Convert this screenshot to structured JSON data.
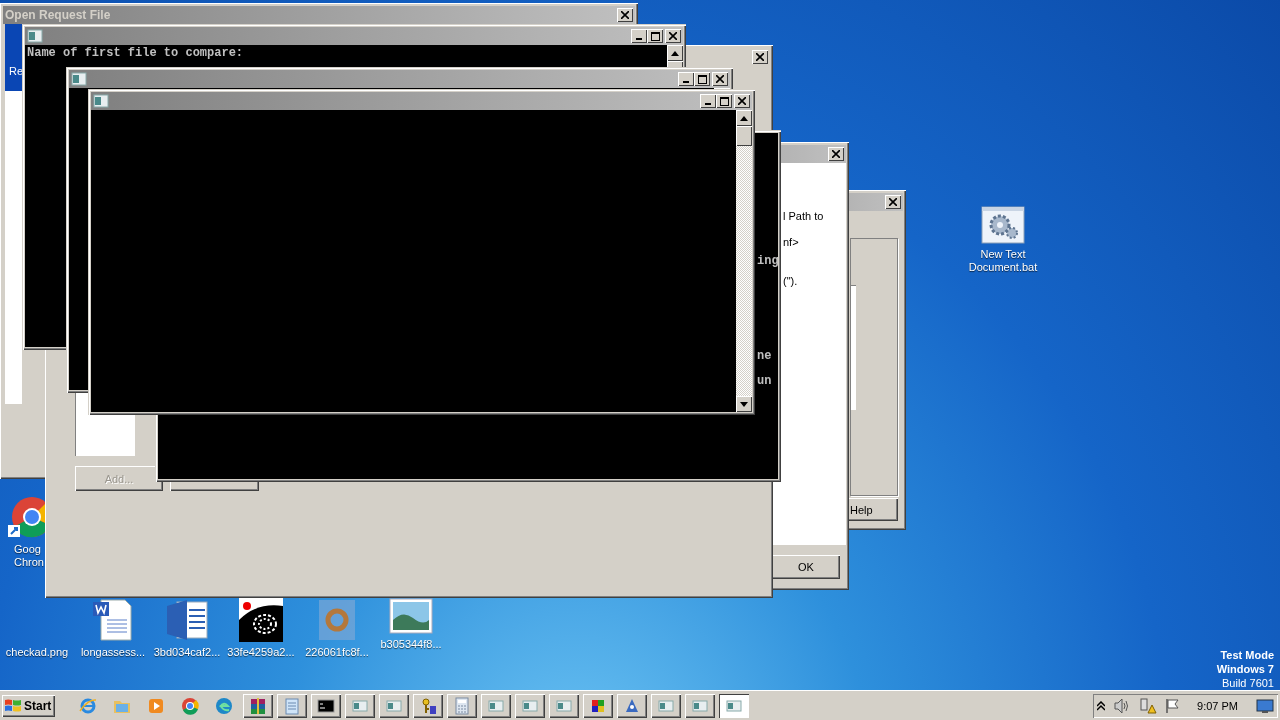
{
  "desktop": {
    "icons": [
      {
        "kind": "chrome",
        "label": "Goog Chron"
      },
      {
        "kind": "batch",
        "label": "New Text Document.bat"
      },
      {
        "kind": "blank",
        "label": "checkad.png"
      },
      {
        "kind": "word-doc",
        "label": "longassess..."
      },
      {
        "kind": "word-app",
        "label": "3bd034caf2..."
      },
      {
        "kind": "fingerprint",
        "label": "33fe4259a2..."
      },
      {
        "kind": "faded",
        "label": "226061fc8f..."
      },
      {
        "kind": "picture",
        "label": "b305344f8..."
      }
    ],
    "system_text": [
      "Test Mode",
      "Windows 7",
      "Build 7601"
    ]
  },
  "open_request_file": {
    "title": "Open Request File",
    "list_item": "Re"
  },
  "help_dialog": {
    "help_button": "Help"
  },
  "message_dialog": {
    "lines": [
      "l Path to",
      "nf>",
      "(\")."
    ],
    "ok_button": "OK"
  },
  "options_window": {
    "add_button": "Add...",
    "add_disabled": true
  },
  "consoles": [
    {
      "lines": [
        "ing",
        "ne",
        "un"
      ]
    },
    {
      "lines": [
        "Name of first file to compare:"
      ]
    }
  ],
  "taskbar": {
    "start": "Start",
    "items": [
      {
        "kind": "ie",
        "selected": false
      },
      {
        "kind": "folder",
        "selected": false
      },
      {
        "kind": "media",
        "selected": false
      },
      {
        "kind": "chrome",
        "selected": false
      },
      {
        "kind": "edge",
        "selected": false
      },
      {
        "kind": "archive",
        "selected": false
      },
      {
        "kind": "notepad",
        "selected": false
      },
      {
        "kind": "cmd",
        "selected": false
      },
      {
        "kind": "console",
        "selected": false
      },
      {
        "kind": "console",
        "selected": false
      },
      {
        "kind": "keys",
        "selected": false
      },
      {
        "kind": "calc",
        "selected": false
      },
      {
        "kind": "console",
        "selected": false
      },
      {
        "kind": "console",
        "selected": false
      },
      {
        "kind": "console",
        "selected": false
      },
      {
        "kind": "puzzle",
        "selected": false
      },
      {
        "kind": "app",
        "selected": false
      },
      {
        "kind": "console",
        "selected": false
      },
      {
        "kind": "console",
        "selected": false
      },
      {
        "kind": "console",
        "selected": true
      }
    ],
    "clock": "9:07 PM"
  }
}
